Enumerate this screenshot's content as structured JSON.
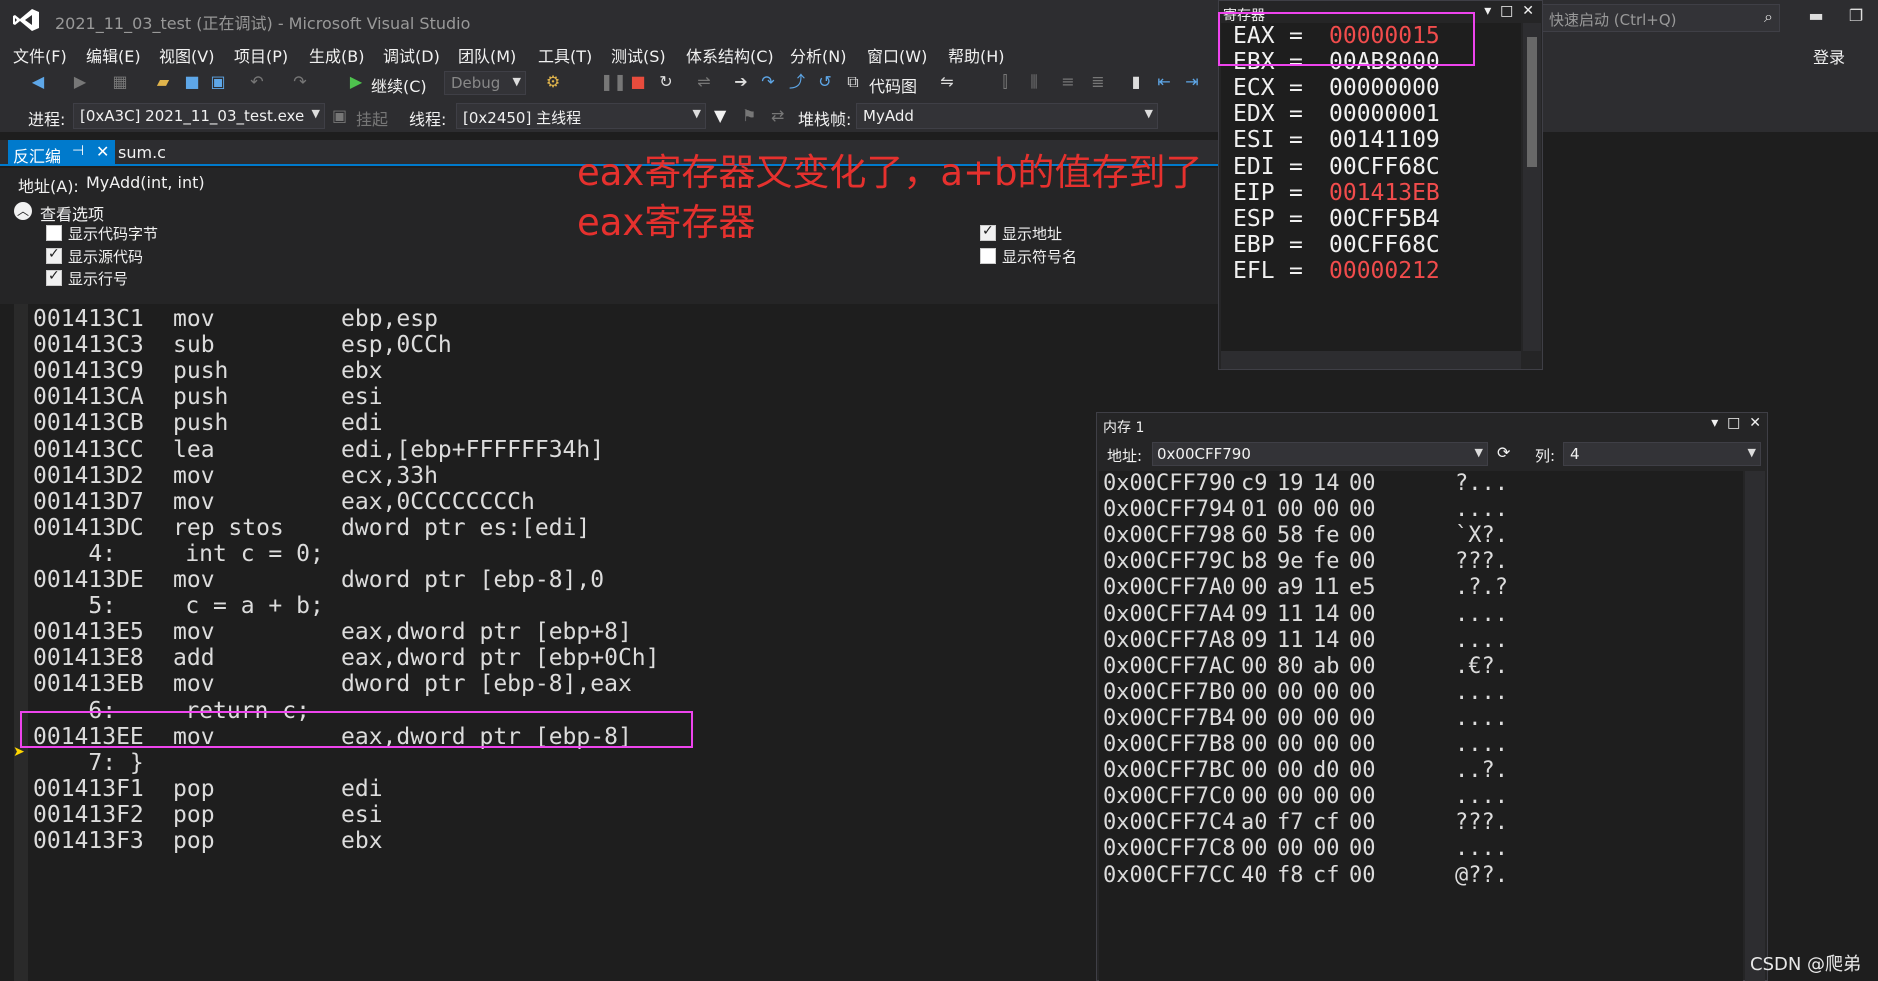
{
  "window": {
    "title": "2021_11_03_test (正在调试) - Microsoft Visual Studio",
    "quick_launch_placeholder": "快速启动 (Ctrl+Q)",
    "login": "登录"
  },
  "menu": [
    "文件(F)",
    "编辑(E)",
    "视图(V)",
    "项目(P)",
    "生成(B)",
    "调试(D)",
    "团队(M)",
    "工具(T)",
    "测试(S)",
    "体系结构(C)",
    "分析(N)",
    "窗口(W)",
    "帮助(H)"
  ],
  "toolbar": {
    "continue_label": "继续(C)",
    "config": "Debug",
    "code_map_label": "代码图"
  },
  "debug_bar": {
    "process_label": "进程:",
    "process_value": "[0xA3C] 2021_11_03_test.exe",
    "suspend_label": "挂起",
    "thread_label": "线程:",
    "thread_value": "[0x2450] 主线程",
    "stackframe_label": "堆栈帧:",
    "stackframe_value": "MyAdd"
  },
  "tabs": {
    "active": "反汇编",
    "other": "sum.c"
  },
  "address_bar": {
    "label": "地址(A):",
    "value": "MyAdd(int, int)"
  },
  "view_options": {
    "title": "查看选项",
    "show_code_bytes": "显示代码字节",
    "show_source": "显示源代码",
    "show_line_numbers": "显示行号",
    "show_address": "显示地址",
    "show_symbol_names": "显示符号名"
  },
  "annotation": {
    "line1": "eax寄存器又变化了，a+b的值存到了",
    "line2": "eax寄存器"
  },
  "disassembly": [
    {
      "kind": "asm",
      "addr": "001413C1",
      "op": "mov",
      "args": "ebp,esp"
    },
    {
      "kind": "asm",
      "addr": "001413C3",
      "op": "sub",
      "args": "esp,0CCh"
    },
    {
      "kind": "asm",
      "addr": "001413C9",
      "op": "push",
      "args": "ebx"
    },
    {
      "kind": "asm",
      "addr": "001413CA",
      "op": "push",
      "args": "esi"
    },
    {
      "kind": "asm",
      "addr": "001413CB",
      "op": "push",
      "args": "edi"
    },
    {
      "kind": "asm",
      "addr": "001413CC",
      "op": "lea",
      "args": "edi,[ebp+FFFFFF34h]"
    },
    {
      "kind": "asm",
      "addr": "001413D2",
      "op": "mov",
      "args": "ecx,33h"
    },
    {
      "kind": "asm",
      "addr": "001413D7",
      "op": "mov",
      "args": "eax,0CCCCCCCCh"
    },
    {
      "kind": "asm",
      "addr": "001413DC",
      "op": "rep stos",
      "args": "dword ptr es:[edi]"
    },
    {
      "kind": "src",
      "text": "    4:     int c = 0;"
    },
    {
      "kind": "asm",
      "addr": "001413DE",
      "op": "mov",
      "args": "dword ptr [ebp-8],0"
    },
    {
      "kind": "src",
      "text": "    5:     c = a + b;"
    },
    {
      "kind": "asm",
      "addr": "001413E5",
      "op": "mov",
      "args": "eax,dword ptr [ebp+8]"
    },
    {
      "kind": "asm",
      "addr": "001413E8",
      "op": "add",
      "args": "eax,dword ptr [ebp+0Ch]"
    },
    {
      "kind": "asm",
      "addr": "001413EB",
      "op": "mov",
      "args": "dword ptr [ebp-8],eax"
    },
    {
      "kind": "src",
      "text": "    6:     return c;"
    },
    {
      "kind": "asm",
      "addr": "001413EE",
      "op": "mov",
      "args": "eax,dword ptr [ebp-8]"
    },
    {
      "kind": "src",
      "text": "    7: }"
    },
    {
      "kind": "asm",
      "addr": "001413F1",
      "op": "pop",
      "args": "edi"
    },
    {
      "kind": "asm",
      "addr": "001413F2",
      "op": "pop",
      "args": "esi"
    },
    {
      "kind": "asm",
      "addr": "001413F3",
      "op": "pop",
      "args": "ebx"
    }
  ],
  "registers": {
    "title": "寄存器",
    "items": [
      {
        "name": "EAX",
        "value": "00000015",
        "changed": true
      },
      {
        "name": "EBX",
        "value": "00AB8000",
        "changed": false
      },
      {
        "name": "ECX",
        "value": "00000000",
        "changed": false
      },
      {
        "name": "EDX",
        "value": "00000001",
        "changed": false
      },
      {
        "name": "ESI",
        "value": "00141109",
        "changed": false
      },
      {
        "name": "EDI",
        "value": "00CFF68C",
        "changed": false
      },
      {
        "name": "EIP",
        "value": "001413EB",
        "changed": true
      },
      {
        "name": "ESP",
        "value": "00CFF5B4",
        "changed": false
      },
      {
        "name": "EBP",
        "value": "00CFF68C",
        "changed": false
      },
      {
        "name": "EFL",
        "value": "00000212",
        "changed": true
      }
    ]
  },
  "memory": {
    "title": "内存 1",
    "addr_label": "地址:",
    "addr_value": "0x00CFF790",
    "col_label": "列:",
    "col_value": "4",
    "rows": [
      {
        "addr": "0x00CFF790",
        "bytes": [
          "c9",
          "19",
          "14",
          "00"
        ],
        "ascii": "?..."
      },
      {
        "addr": "0x00CFF794",
        "bytes": [
          "01",
          "00",
          "00",
          "00"
        ],
        "ascii": "...."
      },
      {
        "addr": "0x00CFF798",
        "bytes": [
          "60",
          "58",
          "fe",
          "00"
        ],
        "ascii": "`X?."
      },
      {
        "addr": "0x00CFF79C",
        "bytes": [
          "b8",
          "9e",
          "fe",
          "00"
        ],
        "ascii": "???."
      },
      {
        "addr": "0x00CFF7A0",
        "bytes": [
          "00",
          "a9",
          "11",
          "e5"
        ],
        "ascii": ".?.?"
      },
      {
        "addr": "0x00CFF7A4",
        "bytes": [
          "09",
          "11",
          "14",
          "00"
        ],
        "ascii": "...."
      },
      {
        "addr": "0x00CFF7A8",
        "bytes": [
          "09",
          "11",
          "14",
          "00"
        ],
        "ascii": "...."
      },
      {
        "addr": "0x00CFF7AC",
        "bytes": [
          "00",
          "80",
          "ab",
          "00"
        ],
        "ascii": ".€?."
      },
      {
        "addr": "0x00CFF7B0",
        "bytes": [
          "00",
          "00",
          "00",
          "00"
        ],
        "ascii": "...."
      },
      {
        "addr": "0x00CFF7B4",
        "bytes": [
          "00",
          "00",
          "00",
          "00"
        ],
        "ascii": "...."
      },
      {
        "addr": "0x00CFF7B8",
        "bytes": [
          "00",
          "00",
          "00",
          "00"
        ],
        "ascii": "...."
      },
      {
        "addr": "0x00CFF7BC",
        "bytes": [
          "00",
          "00",
          "d0",
          "00"
        ],
        "ascii": "..?."
      },
      {
        "addr": "0x00CFF7C0",
        "bytes": [
          "00",
          "00",
          "00",
          "00"
        ],
        "ascii": "...."
      },
      {
        "addr": "0x00CFF7C4",
        "bytes": [
          "a0",
          "f7",
          "cf",
          "00"
        ],
        "ascii": "???."
      },
      {
        "addr": "0x00CFF7C8",
        "bytes": [
          "00",
          "00",
          "00",
          "00"
        ],
        "ascii": "...."
      },
      {
        "addr": "0x00CFF7CC",
        "bytes": [
          "40",
          "f8",
          "cf",
          "00"
        ],
        "ascii": "@??."
      }
    ]
  },
  "watermark": "CSDN @爬弟",
  "colors": {
    "accent": "#007acc",
    "highlight_box": "#ee44ee",
    "annotation": "#e6312e",
    "changed_value": "#f14c4c"
  }
}
